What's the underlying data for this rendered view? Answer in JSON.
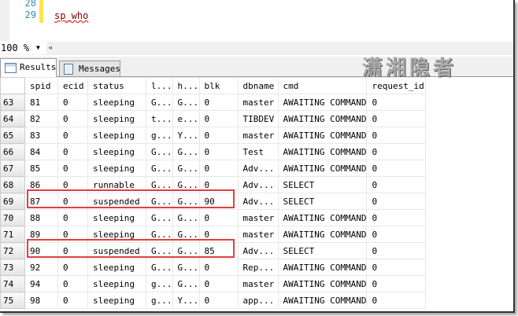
{
  "editor": {
    "lines": [
      {
        "n": "28",
        "code": ""
      },
      {
        "n": "29",
        "code": "sp_who"
      }
    ]
  },
  "zoom": "100 %",
  "tabs": [
    {
      "label": "Results",
      "active": true
    },
    {
      "label": "Messages",
      "active": false
    }
  ],
  "watermark": "潇湘隐者",
  "columns": [
    "",
    "spid",
    "ecid",
    "status",
    "l...",
    "h...",
    "blk",
    "dbname",
    "cmd",
    "request_id"
  ],
  "rows": [
    [
      "63",
      "81",
      "0",
      "sleeping",
      "G...",
      "G...",
      "0",
      "master",
      "AWAITING COMMAND",
      "0"
    ],
    [
      "64",
      "82",
      "0",
      "sleeping",
      "t...",
      "e...",
      "0",
      "TIBDEV",
      "AWAITING COMMAND",
      "0"
    ],
    [
      "65",
      "83",
      "0",
      "sleeping",
      "g...",
      "Y...",
      "0",
      "master",
      "AWAITING COMMAND",
      "0"
    ],
    [
      "66",
      "84",
      "0",
      "sleeping",
      "G...",
      "G...",
      "0",
      "Test",
      "AWAITING COMMAND",
      "0"
    ],
    [
      "67",
      "85",
      "0",
      "sleeping",
      "G...",
      "G...",
      "0",
      "Adv...",
      "AWAITING COMMAND",
      "0"
    ],
    [
      "68",
      "86",
      "0",
      "runnable",
      "G...",
      "G...",
      "0",
      "Adv...",
      "SELECT",
      "0"
    ],
    [
      "69",
      "87",
      "0",
      "suspended",
      "G...",
      "G...",
      "90",
      "Adv...",
      "SELECT",
      "0"
    ],
    [
      "70",
      "88",
      "0",
      "sleeping",
      "G...",
      "G...",
      "0",
      "master",
      "AWAITING COMMAND",
      "0"
    ],
    [
      "71",
      "89",
      "0",
      "sleeping",
      "G...",
      "G...",
      "0",
      "master",
      "AWAITING COMMAND",
      "0"
    ],
    [
      "72",
      "90",
      "0",
      "suspended",
      "G...",
      "G...",
      "85",
      "Adv...",
      "SELECT",
      "0"
    ],
    [
      "73",
      "92",
      "0",
      "sleeping",
      "G...",
      "G...",
      "0",
      "Rep...",
      "AWAITING COMMAND",
      "0"
    ],
    [
      "74",
      "94",
      "0",
      "sleeping",
      "g...",
      "G...",
      "0",
      "master",
      "AWAITING COMMAND",
      "0"
    ],
    [
      "75",
      "98",
      "0",
      "sleeping",
      "g...",
      "Y...",
      "0",
      "app...",
      "AWAITING COMMAND",
      "0"
    ]
  ],
  "highlight_color": "#e04040"
}
